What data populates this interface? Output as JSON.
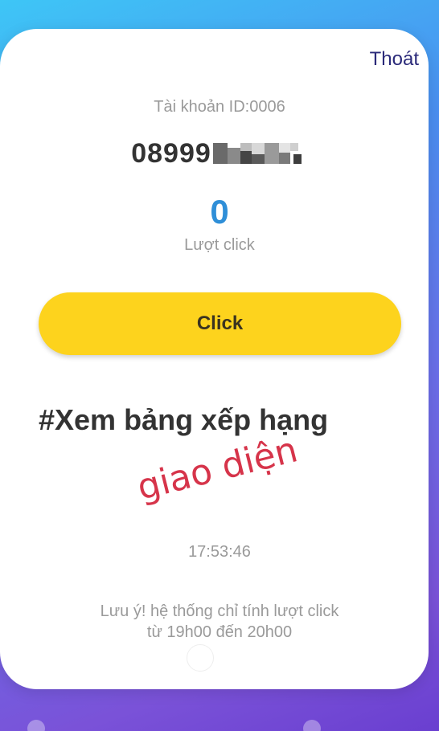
{
  "header": {
    "logout_label": "Thoát"
  },
  "account": {
    "id_label": "Tài khoản ID:0006",
    "phone_prefix": "08999"
  },
  "clicks": {
    "count": "0",
    "label": "Lượt click"
  },
  "actions": {
    "click_button_label": "Click",
    "ranking_link": "#Xem bảng xếp hạng"
  },
  "overlay": {
    "annotation": "giao diện"
  },
  "clock": {
    "time": "17:53:46"
  },
  "note": {
    "line1": "Lưu ý! hệ thống chỉ tính lượt click",
    "line2": "từ 19h00 đến 20h00"
  },
  "colors": {
    "button": "#fdd31d",
    "count": "#2f8fd8",
    "annotation": "#d6344a",
    "logout": "#2b2a7a"
  }
}
